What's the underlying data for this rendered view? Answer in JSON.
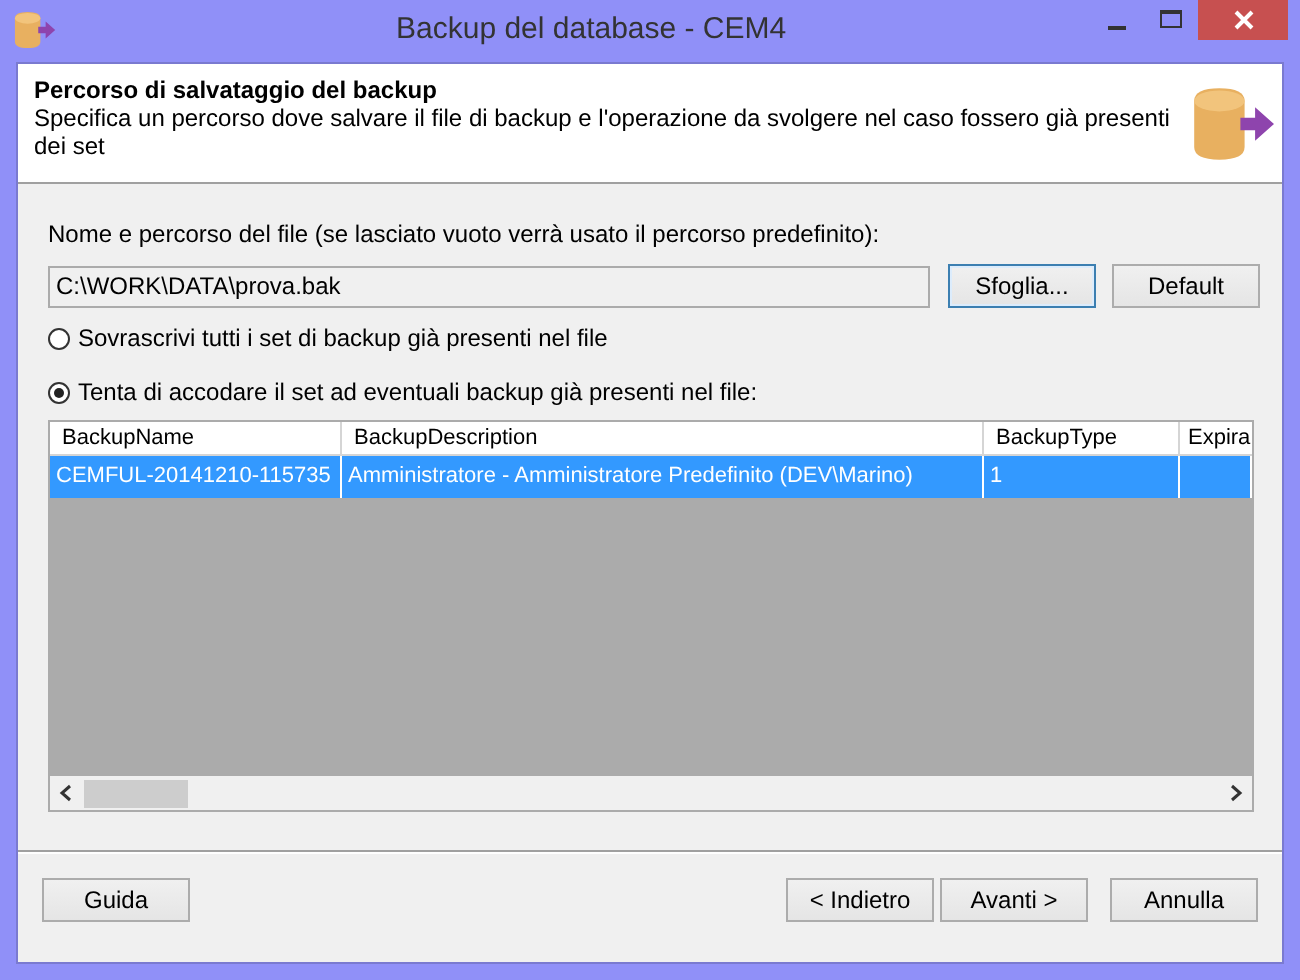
{
  "window": {
    "title": "Backup del database - CEM4"
  },
  "header": {
    "title": "Percorso di salvataggio del backup",
    "description": "Specifica un percorso dove salvare il file di backup e l'operazione da svolgere nel caso fossero già presenti dei set"
  },
  "file_label": "Nome e percorso del file (se lasciato vuoto verrà usato il percorso predefinito):",
  "file_field": {
    "value": "C:\\WORK\\DATA\\prova.bak"
  },
  "file_buttons": [
    {
      "label": "Sfoglia...",
      "focused": true
    },
    {
      "label": "Default",
      "focused": false
    }
  ],
  "options": [
    {
      "label": "Sovrascrivi tutti i set di backup già presenti nel file",
      "selected": false
    },
    {
      "label": "Tenta di accodare il set ad eventuali backup già presenti nel file:",
      "selected": true
    }
  ],
  "table": {
    "columns": [
      "BackupName",
      "BackupDescription",
      "BackupType",
      "Expira"
    ],
    "rows": [
      {
        "cells": [
          "CEMFUL-20141210-115735",
          "Amministratore - Amministratore Predefinito (DEV\\Marino)",
          "1",
          ""
        ],
        "selected": true
      }
    ]
  },
  "help_button": {
    "label": "Guida"
  },
  "nav_buttons": [
    {
      "label": "< Indietro"
    },
    {
      "label": "Avanti >"
    },
    {
      "label": "Annulla"
    }
  ]
}
